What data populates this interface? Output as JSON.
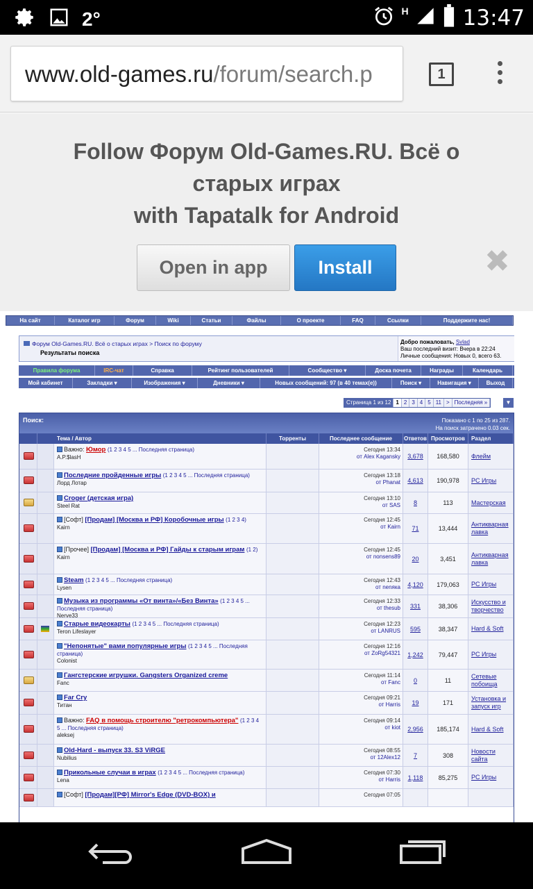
{
  "status": {
    "temp": "2°",
    "net": "H",
    "time": "13:47"
  },
  "browser": {
    "url_host": "www.old-games.ru",
    "url_rest": "/forum/search.p",
    "tabs_count": "1"
  },
  "banner": {
    "line1": "Follow Форум Old-Games.RU. Всё о",
    "line2": "старых играх",
    "line3": "with Tapatalk for Android",
    "open": "Open in app",
    "install": "Install"
  },
  "topnav": [
    "На сайт",
    "Каталог игр",
    "Форум",
    "Wiki",
    "Статьи",
    "Файлы",
    "О проекте",
    "FAQ",
    "Ссылки",
    "Поддержите нас!"
  ],
  "crumb": {
    "path": "Форум Old-Games.RU. Всё о старых играх > Поиск по форуму",
    "current": "Результаты поиска"
  },
  "welcome": {
    "hello": "Добро пожаловать,",
    "user": "Svlad",
    "last": "Ваш последний визит: Вчера в 22:24",
    "pm": "Личные сообщения: Новых 0, всего 63."
  },
  "bar1": [
    "Правила форума",
    "IRC-чат",
    "Справка",
    "Рейтинг пользователей",
    "Сообщество ▾",
    "Доска почета",
    "Награды",
    "Календарь"
  ],
  "bar2": [
    "Мой кабинет",
    "Закладки ▾",
    "Изображения ▾",
    "Дневники ▾",
    "Новых сообщений: 97 (в 40 темах(е))",
    "Поиск ▾",
    "Навигация ▾",
    "Выход"
  ],
  "pager": {
    "label": "Страница 1 из 12",
    "pages": [
      "1",
      "2",
      "3",
      "4",
      "5",
      "11",
      ">",
      "Последняя »"
    ]
  },
  "results": {
    "title": "Поиск:",
    "shown": "Показано с 1 по 25 из 287.",
    "time": "На поиск затрачено 0.03 сек."
  },
  "headers": [
    "Тема / Автор",
    "Торренты",
    "Последнее сообщение",
    "Ответов",
    "Просмотров",
    "Раздел"
  ],
  "rows": [
    {
      "prefix": "Важно:",
      "title": "Юмор",
      "pages": "(1 2 3 4 5 ... Последняя страница)",
      "author": "A.P.$lasH",
      "time": "Сегодня 13:34",
      "by": "от Alex Kagansky",
      "replies": "3,678",
      "views": "168,580",
      "section": "Флейм"
    },
    {
      "prefix": "",
      "title": "Последние пройденные игры",
      "pages": "(1 2 3 4 5 ... Последняя страница)",
      "author": "Лорд Лотар",
      "time": "Сегодня 13:18",
      "by": "от Phanat",
      "replies": "4,613",
      "views": "190,978",
      "section": "PC Игры"
    },
    {
      "prefix": "",
      "title": "Croger (детская игра)",
      "pages": "",
      "author": "Steel Rat",
      "time": "Сегодня 13:10",
      "by": "от SAS",
      "replies": "8",
      "views": "113",
      "section": "Мастерская"
    },
    {
      "prefix": "[Софт]",
      "title": "[Продам] [Москва и РФ] Коробочные игры",
      "pages": "(1 2 3 4)",
      "author": "Kairn",
      "time": "Сегодня 12:45",
      "by": "от Kairn",
      "replies": "71",
      "views": "13,444",
      "section": "Антикварная лавка"
    },
    {
      "prefix": "[Прочее]",
      "title": "[Продам] [Москва и РФ] Гайды к старым играм",
      "pages": "(1 2)",
      "author": "Kairn",
      "time": "Сегодня 12:45",
      "by": "от nonsens89",
      "replies": "20",
      "views": "3,451",
      "section": "Антикварная лавка"
    },
    {
      "prefix": "",
      "title": "Steam",
      "pages": "(1 2 3 4 5 ... Последняя страница)",
      "author": "Lysen",
      "time": "Сегодня 12:43",
      "by": "от nenяка",
      "replies": "4,120",
      "views": "179,063",
      "section": "PC Игры"
    },
    {
      "prefix": "",
      "title": "Музыка из программы «От винта»/«Без Винта»",
      "pages": "(1 2 3 4 5 ... Последняя страница)",
      "author": "Nerve33",
      "time": "Сегодня 12:33",
      "by": "от thesub",
      "replies": "331",
      "views": "38,306",
      "section": "Искусство и творчество"
    },
    {
      "prefix": "",
      "title": "Старые видеокарты",
      "pages": "(1 2 3 4 5 ... Последняя страница)",
      "author": "Teron Lifeslayer",
      "time": "Сегодня 12:23",
      "by": "от LANRUS",
      "replies": "595",
      "views": "38,347",
      "section": "Hard & Soft"
    },
    {
      "prefix": "",
      "title": "\"Непонятые\" вами популярные игры",
      "pages": "(1 2 3 4 5 ... Последняя страница)",
      "author": "Colonist",
      "time": "Сегодня 12:16",
      "by": "от ZoRg54321",
      "replies": "1,242",
      "views": "79,447",
      "section": "PC Игры"
    },
    {
      "prefix": "",
      "title": "Гангстерские игрушки. Gangsters Organized creme",
      "pages": "",
      "author": "Fanc",
      "time": "Сегодня 11:14",
      "by": "от Fanc",
      "replies": "0",
      "views": "11",
      "section": "Сетевые побоища"
    },
    {
      "prefix": "",
      "title": "Far Cry",
      "pages": "",
      "author": "Титан",
      "time": "Сегодня 09:21",
      "by": "от Harris",
      "replies": "19",
      "views": "171",
      "section": "Установка и запуск игр"
    },
    {
      "prefix": "Важно:",
      "title": "FAQ в помощь строителю \"ретрокомпьютера\"",
      "pages": "(1 2 3 4 5 ... Последняя страница)",
      "author": "aleksej",
      "time": "Сегодня 09:14",
      "by": "от kiot",
      "replies": "2,956",
      "views": "185,174",
      "section": "Hard & Soft"
    },
    {
      "prefix": "",
      "title": "Old-Hard - выпуск 33. S3 ViRGE",
      "pages": "",
      "author": "Nubilius",
      "time": "Сегодня 08:55",
      "by": "от 12Alex12",
      "replies": "7",
      "views": "308",
      "section": "Новости сайта"
    },
    {
      "prefix": "",
      "title": "Прикольные случаи в играх",
      "pages": "(1 2 3 4 5 ... Последняя страница)",
      "author": "Lena",
      "time": "Сегодня 07:30",
      "by": "от Harris",
      "replies": "1,118",
      "views": "85,275",
      "section": "PC Игры"
    },
    {
      "prefix": "[Софт]",
      "title": "[Продам][РФ] Mirror's Edge (DVD-BOX) и",
      "pages": "",
      "author": "",
      "time": "Сегодня 07:05",
      "by": "",
      "replies": "",
      "views": "",
      "section": ""
    }
  ]
}
